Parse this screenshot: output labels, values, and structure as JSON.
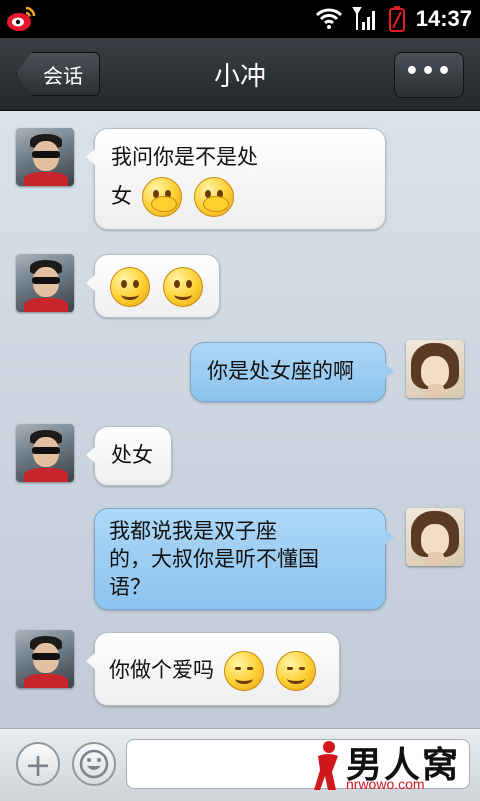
{
  "status_bar": {
    "time": "14:37",
    "icons": [
      "weibo-icon",
      "wifi-icon",
      "signal-icon",
      "battery-empty-icon"
    ]
  },
  "nav": {
    "back_label": "会话",
    "title": "小冲",
    "more_label": "•••"
  },
  "messages": [
    {
      "side": "in",
      "avatar": "avatar-man",
      "text_lines": [
        "我问你是不是处",
        "女"
      ],
      "emojis": [
        "shy-emoji",
        "shy-emoji"
      ]
    },
    {
      "side": "in",
      "avatar": "avatar-man",
      "text_lines": [],
      "emojis": [
        "smile-emoji",
        "smile-emoji"
      ]
    },
    {
      "side": "out",
      "avatar": "avatar-girl",
      "text_lines": [
        "你是处女座的啊"
      ]
    },
    {
      "side": "in",
      "avatar": "avatar-man",
      "text_lines": [
        "处女"
      ]
    },
    {
      "side": "out",
      "avatar": "avatar-girl",
      "text_lines": [
        "我都说我是双子座",
        "的，大叔你是听不懂国",
        "语？"
      ]
    },
    {
      "side": "in",
      "avatar": "avatar-man",
      "text_lines": [
        "你做个爱吗"
      ],
      "emojis": [
        "content-emoji",
        "content-emoji"
      ]
    }
  ],
  "input_bar": {
    "plus_label": "+",
    "input_value": "",
    "input_placeholder": ""
  },
  "watermark": {
    "text": "男人窝",
    "url": "nrwowo.com"
  },
  "colors": {
    "incoming_bubble": "#ffffff",
    "outgoing_bubble": "#9dcdf2",
    "nav_bar": "#2a2e33",
    "watermark_red": "#d2161e"
  }
}
